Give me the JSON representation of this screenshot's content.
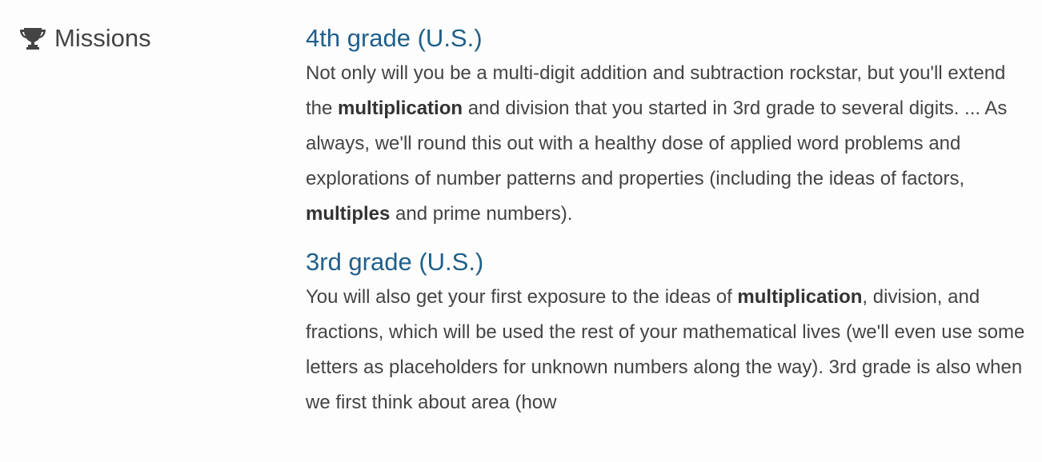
{
  "sidebar": {
    "icon": "trophy-icon",
    "heading": "Missions"
  },
  "results": [
    {
      "title": "4th grade (U.S.)",
      "description": [
        {
          "text": "Not only will you be a multi-digit addition and subtraction rockstar, but you'll extend the ",
          "bold": false
        },
        {
          "text": "multiplication",
          "bold": true
        },
        {
          "text": " and division that you started in 3rd grade to several digits. ... As always, we'll round this out with a healthy dose of applied word problems and explorations of number patterns and properties (including the ideas of factors, ",
          "bold": false
        },
        {
          "text": "multiples",
          "bold": true
        },
        {
          "text": " and prime numbers).",
          "bold": false
        }
      ]
    },
    {
      "title": "3rd grade (U.S.)",
      "description": [
        {
          "text": "You will also get your first exposure to the ideas of ",
          "bold": false
        },
        {
          "text": "multiplication",
          "bold": true
        },
        {
          "text": ", division, and fractions, which will be used the rest of your mathematical lives (we'll even use some letters as placeholders for unknown numbers along the way). 3rd grade is also when we first think about area (how",
          "bold": false
        }
      ]
    }
  ],
  "colors": {
    "link": "#1f5f8b",
    "text": "#444444",
    "background": "#fdfdfd"
  }
}
